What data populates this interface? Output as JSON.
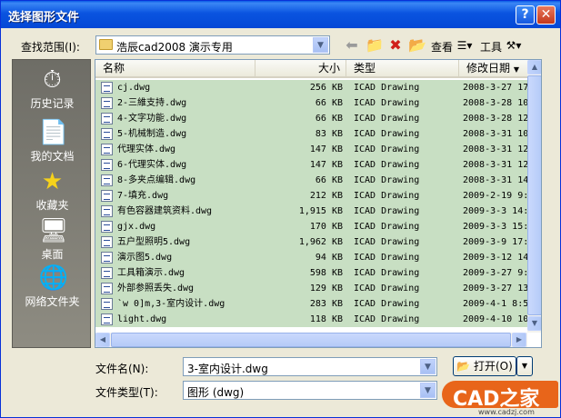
{
  "dialog": {
    "title": "选择图形文件",
    "help": "?",
    "close": "✕"
  },
  "lookin": {
    "label": "查找范围(I):",
    "value": "浩辰cad2008 演示专用"
  },
  "toolbar": {
    "views_label": "查看",
    "tools_label": "工具"
  },
  "places": [
    {
      "label": "历史记录",
      "icon": "history-icon",
      "glyph": "⏱"
    },
    {
      "label": "我的文档",
      "icon": "my-documents-icon",
      "glyph": "📄"
    },
    {
      "label": "收藏夹",
      "icon": "favorites-icon",
      "glyph": "★"
    },
    {
      "label": "桌面",
      "icon": "desktop-icon",
      "glyph": "🖥"
    },
    {
      "label": "网络文件夹",
      "icon": "network-folder-icon",
      "glyph": "🌐"
    }
  ],
  "columns": {
    "name": "名称",
    "size": "大小",
    "type": "类型",
    "date": "修改日期"
  },
  "files": [
    {
      "name": "cj.dwg",
      "size": "256 KB",
      "type": "ICAD Drawing",
      "date": "2008-3-27 17"
    },
    {
      "name": "2-三維支持.dwg",
      "size": "66 KB",
      "type": "ICAD Drawing",
      "date": "2008-3-28 10"
    },
    {
      "name": "4-文字功能.dwg",
      "size": "66 KB",
      "type": "ICAD Drawing",
      "date": "2008-3-28 12"
    },
    {
      "name": "5-机械制造.dwg",
      "size": "83 KB",
      "type": "ICAD Drawing",
      "date": "2008-3-31 10"
    },
    {
      "name": "代理实体.dwg",
      "size": "147 KB",
      "type": "ICAD Drawing",
      "date": "2008-3-31 12"
    },
    {
      "name": "6-代理实体.dwg",
      "size": "147 KB",
      "type": "ICAD Drawing",
      "date": "2008-3-31 12"
    },
    {
      "name": "8-多夹点编辑.dwg",
      "size": "66 KB",
      "type": "ICAD Drawing",
      "date": "2008-3-31 14"
    },
    {
      "name": "7-填充.dwg",
      "size": "212 KB",
      "type": "ICAD Drawing",
      "date": "2009-2-19 9:"
    },
    {
      "name": "有色容器建筑资料.dwg",
      "size": "1,915 KB",
      "type": "ICAD Drawing",
      "date": "2009-3-3 14:"
    },
    {
      "name": "gjx.dwg",
      "size": "170 KB",
      "type": "ICAD Drawing",
      "date": "2009-3-3 15:"
    },
    {
      "name": "五户型照明5.dwg",
      "size": "1,962 KB",
      "type": "ICAD Drawing",
      "date": "2009-3-9 17:"
    },
    {
      "name": "演示图5.dwg",
      "size": "94 KB",
      "type": "ICAD Drawing",
      "date": "2009-3-12 14"
    },
    {
      "name": "工具箱演示.dwg",
      "size": "598 KB",
      "type": "ICAD Drawing",
      "date": "2009-3-27 9:"
    },
    {
      "name": "外部参照丢失.dwg",
      "size": "129 KB",
      "type": "ICAD Drawing",
      "date": "2009-3-27 13"
    },
    {
      "name": "`w   0]m,3-室内设计.dwg",
      "size": "283 KB",
      "type": "ICAD Drawing",
      "date": "2009-4-1 8:5"
    },
    {
      "name": "light.dwg",
      "size": "118 KB",
      "type": "ICAD Drawing",
      "date": "2009-4-10 10"
    }
  ],
  "filename": {
    "label": "文件名(N):",
    "value": "3-室内设计.dwg"
  },
  "filetype": {
    "label": "文件类型(T):",
    "value": "图形 (dwg)"
  },
  "buttons": {
    "open": "打开(O)",
    "open_arrow": "▼"
  },
  "watermark": {
    "text": "CAD之家",
    "url": "www.cadzj.com"
  }
}
